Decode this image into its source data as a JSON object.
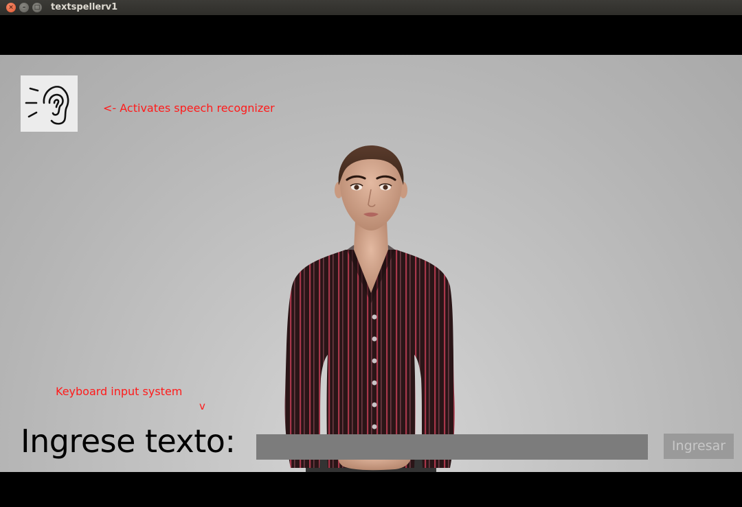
{
  "window": {
    "title": "textspellerv1",
    "close_glyph": "×",
    "minimize_glyph": "–",
    "maximize_glyph": "□"
  },
  "scene": {
    "mic_icon": "ear-icon",
    "speech_hint": "<- Activates speech recognizer",
    "keyboard_hint": "Keyboard input system",
    "keyboard_arrow": "v",
    "hint_color": "#ff1a1a"
  },
  "input_bar": {
    "label": "Ingrese texto:",
    "value": "",
    "submit_label": "Ingresar"
  }
}
